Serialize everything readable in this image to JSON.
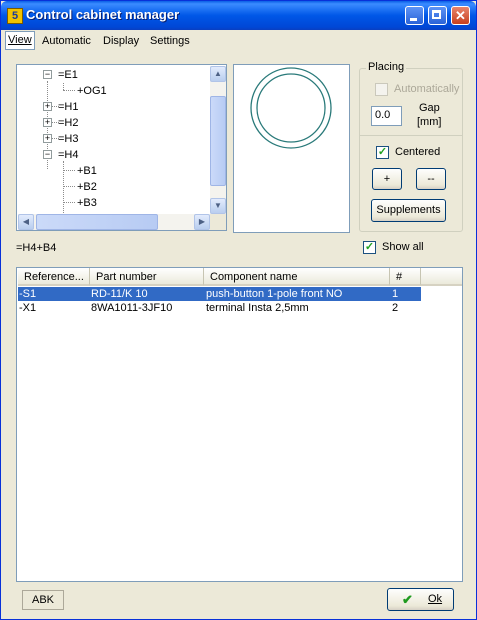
{
  "window": {
    "title": "Control cabinet manager",
    "app_icon_letter": "5"
  },
  "menu": [
    "View",
    "Automatic",
    "Display",
    "Settings"
  ],
  "tree": {
    "nodes": [
      {
        "label": "=E1",
        "expander": "−"
      },
      {
        "label": "+OG1",
        "expander": ""
      },
      {
        "label": "=H1",
        "expander": "+"
      },
      {
        "label": "=H2",
        "expander": "+"
      },
      {
        "label": "=H3",
        "expander": "+"
      },
      {
        "label": "=H4",
        "expander": "−"
      },
      {
        "label": "+B1",
        "expander": ""
      },
      {
        "label": "+B2",
        "expander": ""
      },
      {
        "label": "+B3",
        "expander": ""
      }
    ]
  },
  "placing": {
    "group_title": "Placing",
    "automatically_label": "Automatically",
    "gap_label": "Gap",
    "gap_unit": "[mm]",
    "gap_value": "0.0",
    "centered_label": "Centered",
    "plus_button": "+",
    "minus_button": "--",
    "supplements_button": "Supplements"
  },
  "selection_path": "=H4+B4",
  "show_all_label": "Show all",
  "table": {
    "columns": [
      "Reference...",
      "Part number",
      "Component name",
      "#"
    ],
    "rows": [
      {
        "reference": "-S1",
        "part_number": "RD-11/K 10",
        "component_name": "push-button 1-pole front NO",
        "count": "1",
        "selected": true
      },
      {
        "reference": "-X1",
        "part_number": "8WA1011-3JF10",
        "component_name": "terminal Insta 2,5mm",
        "count": "2",
        "selected": false
      }
    ]
  },
  "status": {
    "abk": "ABK"
  },
  "ok_button": "Ok",
  "colors": {
    "selection": "#316ac5",
    "title_bar": "#0057e7",
    "circle": "#2a7a7a"
  }
}
